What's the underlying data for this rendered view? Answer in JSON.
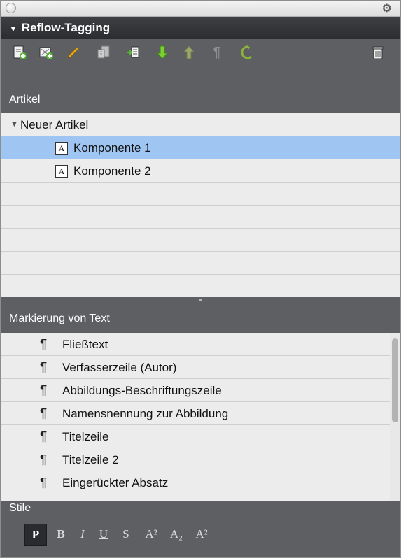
{
  "panel": {
    "title": "Reflow-Tagging"
  },
  "toolbar": {
    "icons": [
      "new-article-icon",
      "add-component-icon",
      "pencil-icon",
      "component-icon",
      "merge-icon",
      "move-down-icon",
      "move-up-icon",
      "paragraph-icon",
      "undo-icon",
      "trash-icon"
    ]
  },
  "articles": {
    "header": "Artikel",
    "group_label": "Neuer Artikel",
    "items": [
      {
        "label": "Komponente 1",
        "selected": true
      },
      {
        "label": "Komponente 2",
        "selected": false
      }
    ]
  },
  "markup": {
    "header": "Markierung von Text",
    "items": [
      "Fließtext",
      "Verfasserzeile (Autor)",
      "Abbildungs-Beschriftungszeile",
      "Namensnennung zur Abbildung",
      "Titelzeile",
      "Titelzeile 2",
      "Eingerückter Absatz"
    ]
  },
  "styles": {
    "header": "Stile",
    "buttons": [
      {
        "label": "P",
        "active": true
      },
      {
        "label": "B",
        "active": false
      },
      {
        "label": "I",
        "active": false
      },
      {
        "label": "U",
        "active": false
      },
      {
        "label": "S",
        "active": false
      },
      {
        "label": "A²",
        "active": false
      },
      {
        "label": "A₂",
        "active": false
      },
      {
        "label": "A²",
        "active": false
      }
    ]
  },
  "colors": {
    "panel_dark": "#2b2d31",
    "toolbar": "#5d5f63",
    "selection": "#9fc5f2"
  }
}
